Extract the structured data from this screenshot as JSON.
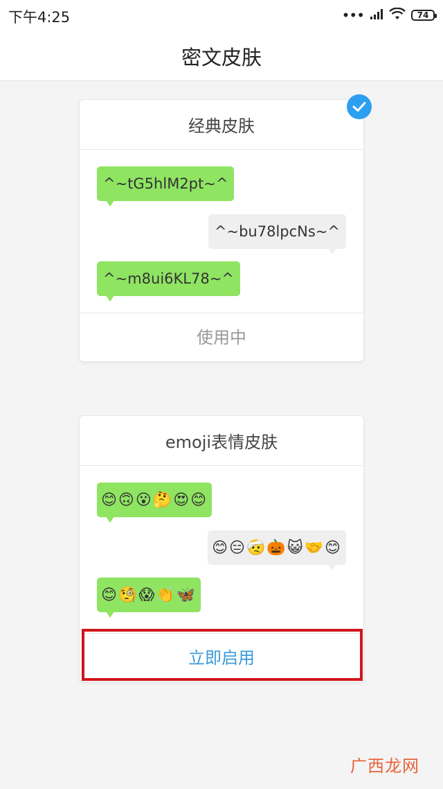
{
  "status_bar": {
    "time": "下午4:25",
    "signal_dots": "•••",
    "battery": "74"
  },
  "header": {
    "title": "密文皮肤"
  },
  "skins": [
    {
      "title": "经典皮肤",
      "selected": true,
      "messages": [
        {
          "side": "left",
          "text": "^~tG5hlM2pt~^"
        },
        {
          "side": "right",
          "text": "^~bu78lpcNs~^"
        },
        {
          "side": "left",
          "text": "^~m8ui6KL78~^"
        }
      ],
      "action_label": "使用中"
    },
    {
      "title": "emoji表情皮肤",
      "selected": false,
      "messages": [
        {
          "side": "left",
          "text": "😊🙃😮🤔😍😊"
        },
        {
          "side": "right",
          "text": "😊😑🤕🎃😺🤝😊"
        },
        {
          "side": "left",
          "text": "😊🧐😱👏🦋"
        }
      ],
      "action_label": "立即启用"
    }
  ],
  "watermark": "广西龙网",
  "colors": {
    "bubble_green": "#8fe462",
    "bubble_gray": "#efefef",
    "accent_blue": "#2d9ff0",
    "action_blue": "#3a9ad9",
    "in_use_gray": "#999999",
    "highlight_red": "#d0161b"
  }
}
